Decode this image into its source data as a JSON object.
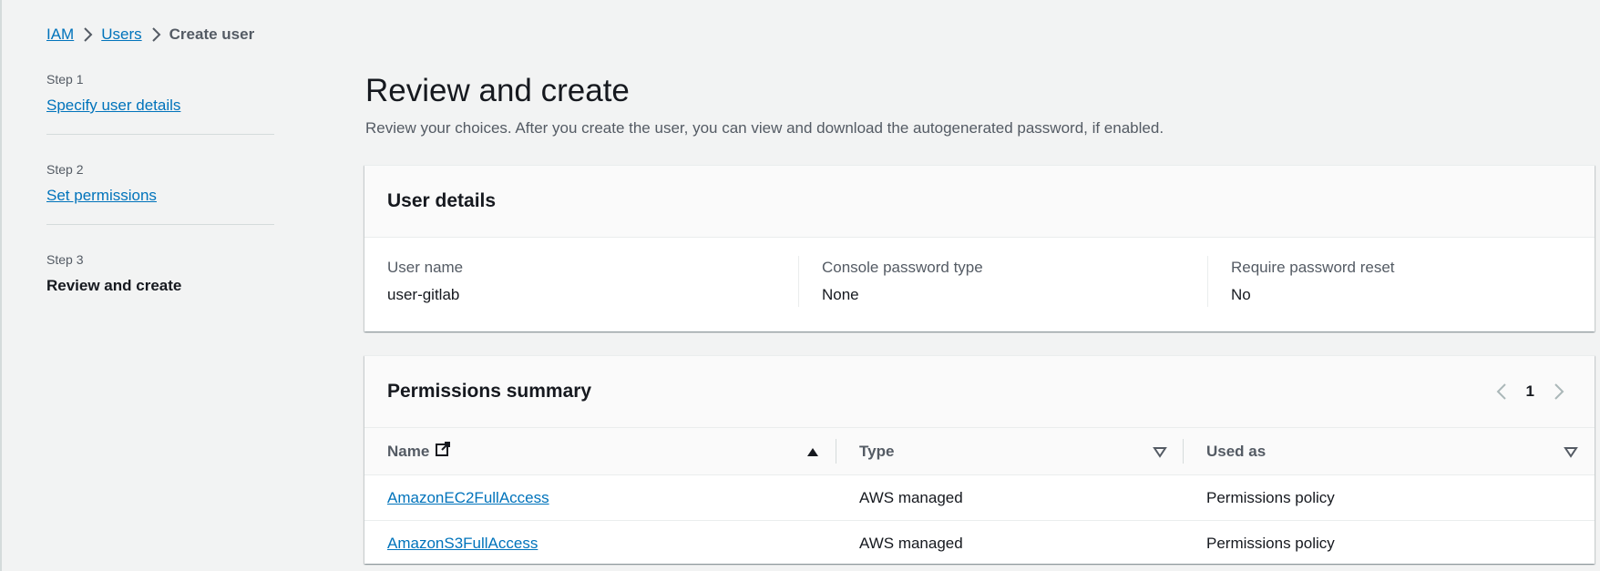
{
  "breadcrumb": {
    "items": [
      "IAM",
      "Users"
    ],
    "current": "Create user"
  },
  "steps": [
    {
      "label": "Step 1",
      "title": "Specify user details"
    },
    {
      "label": "Step 2",
      "title": "Set permissions"
    },
    {
      "label": "Step 3",
      "title": "Review and create"
    }
  ],
  "header": {
    "title": "Review and create",
    "description": "Review your choices. After you create the user, you can view and download the autogenerated password, if enabled."
  },
  "user_details": {
    "title": "User details",
    "fields": [
      {
        "label": "User name",
        "value": "user-gitlab"
      },
      {
        "label": "Console password type",
        "value": "None"
      },
      {
        "label": "Require password reset",
        "value": "No"
      }
    ]
  },
  "permissions": {
    "title": "Permissions summary",
    "page": "1",
    "columns": [
      "Name",
      "Type",
      "Used as"
    ],
    "rows": [
      {
        "name": "AmazonEC2FullAccess",
        "type": "AWS managed",
        "used_as": "Permissions policy"
      },
      {
        "name": "AmazonS3FullAccess",
        "type": "AWS managed",
        "used_as": "Permissions policy"
      }
    ]
  },
  "colors": {
    "link": "#0073bb",
    "text": "#16191f",
    "secondary_text": "#545b64",
    "background": "#f2f3f3"
  }
}
